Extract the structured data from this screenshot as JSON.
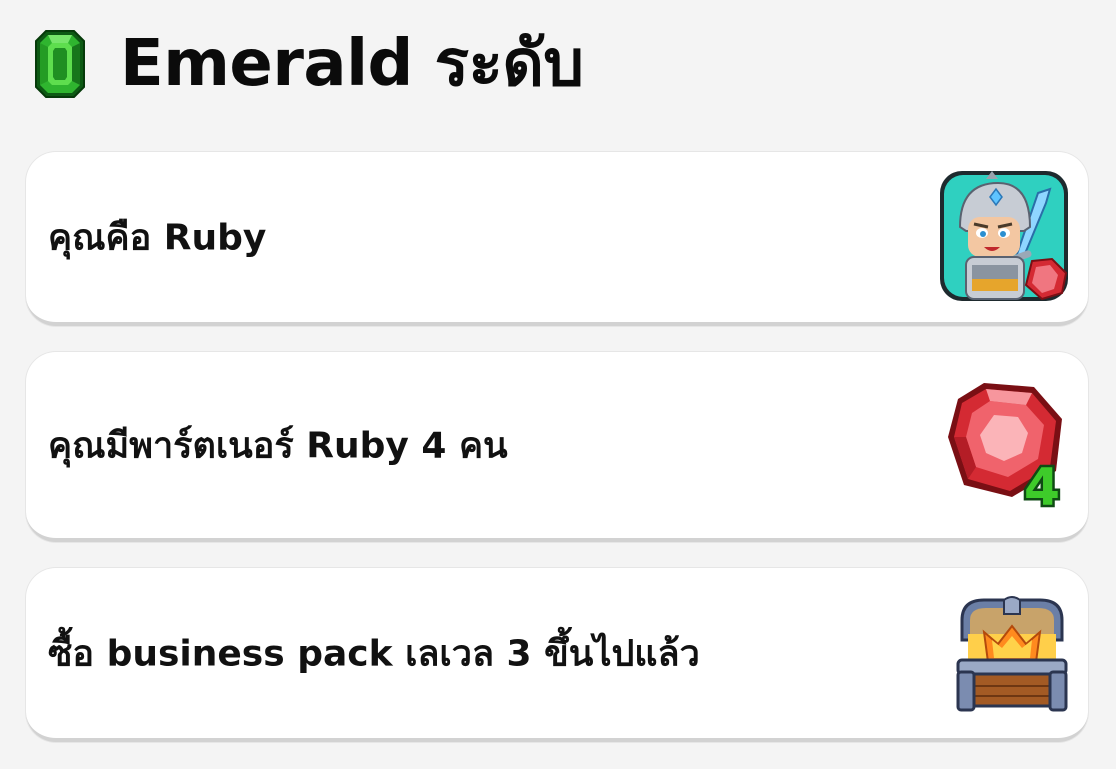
{
  "header": {
    "title": "Emerald ระดับ",
    "icon": "emerald-gem-icon"
  },
  "requirements": [
    {
      "label": "คุณคือ Ruby",
      "icon": "ruby-knight-avatar-icon"
    },
    {
      "label": "คุณมีพาร์ตเนอร์ Ruby 4 คน",
      "icon": "ruby-gem-4-icon",
      "badge": "4"
    },
    {
      "label": "ซื้อ business pack เลเวล 3 ขึ้นไปแล้ว",
      "icon": "treasure-chest-icon"
    }
  ],
  "colors": {
    "background": "#f4f4f4",
    "card": "#ffffff",
    "emerald": "#2fb52f",
    "ruby": "#e2353d",
    "badge_green": "#3ecb2a"
  }
}
